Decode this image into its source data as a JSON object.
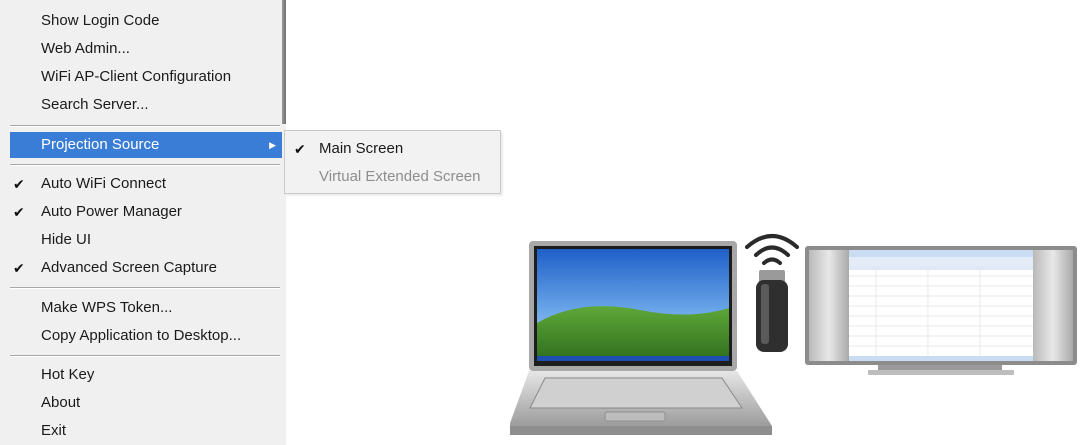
{
  "menu": {
    "items": [
      {
        "label": "Show Login Code",
        "checked": false
      },
      {
        "label": "Web Admin...",
        "checked": false
      },
      {
        "label": "WiFi AP-Client Configuration",
        "checked": false
      },
      {
        "label": "Search Server...",
        "checked": false
      },
      {
        "label": "Projection Source",
        "checked": false,
        "highlighted": true,
        "has_submenu": true
      },
      {
        "label": "Auto WiFi Connect",
        "checked": true
      },
      {
        "label": "Auto Power Manager",
        "checked": true
      },
      {
        "label": "Hide UI",
        "checked": false
      },
      {
        "label": "Advanced Screen Capture",
        "checked": true
      },
      {
        "label": "Make WPS Token...",
        "checked": false
      },
      {
        "label": "Copy Application to Desktop...",
        "checked": false
      },
      {
        "label": "Hot Key",
        "checked": false
      },
      {
        "label": "About",
        "checked": false
      },
      {
        "label": "Exit",
        "checked": false
      }
    ],
    "check_glyph": "✔",
    "arrow_glyph": "▶",
    "highlight_color": "#3a7dd6"
  },
  "submenu": {
    "items": [
      {
        "label": "Main Screen",
        "checked": true,
        "enabled": true
      },
      {
        "label": "Virtual Extended Screen",
        "checked": false,
        "enabled": false
      }
    ]
  },
  "illustration": {
    "icons": [
      "laptop-icon",
      "wifi-signal-icon",
      "wireless-dongle-icon",
      "projection-screen-icon"
    ]
  }
}
